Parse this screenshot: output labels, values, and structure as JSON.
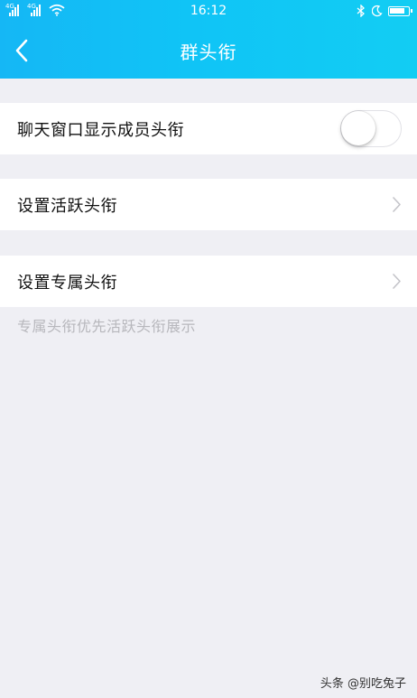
{
  "status_bar": {
    "carrier_tag_1": "4G",
    "carrier_tag_2": "4G",
    "time": "16:12"
  },
  "nav": {
    "title": "群头衔",
    "back_icon": "chevron-left-icon"
  },
  "settings": {
    "show_member_title": {
      "label": "聊天窗口显示成员头衔",
      "enabled": false
    },
    "set_active_title": {
      "label": "设置活跃头衔",
      "icon": "chevron-right-icon"
    },
    "set_exclusive_title": {
      "label": "设置专属头衔",
      "icon": "chevron-right-icon"
    },
    "footnote": "专属头衔优先活跃头衔展示"
  },
  "watermark": "头条 @别吃兔子",
  "colors": {
    "header_gradient_start": "#15b7f5",
    "header_gradient_end": "#12cdf3",
    "background": "#efeff4",
    "row_background": "#ffffff",
    "footnote_text": "#b7b7bc"
  }
}
